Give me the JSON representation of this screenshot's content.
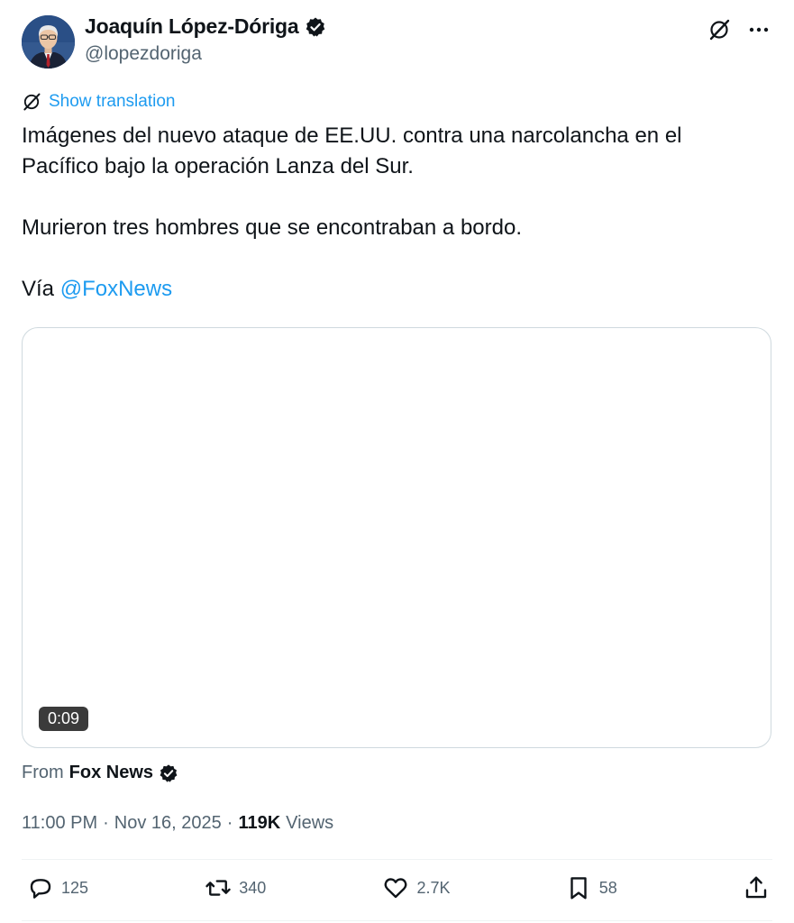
{
  "author": {
    "display_name": "Joaquín López-Dóriga",
    "handle": "@lopezdoriga"
  },
  "translate": {
    "label": "Show translation"
  },
  "tweet": {
    "line1": "Imágenes del nuevo ataque de EE.UU. contra una narcolancha en el Pacífico bajo la operación Lanza del Sur.",
    "line2": "Murieron tres hombres que se encontraban a bordo.",
    "via_prefix": "Vía ",
    "mention": "@FoxNews"
  },
  "media": {
    "duration": "0:09"
  },
  "source": {
    "from_label": "From",
    "name": "Fox News"
  },
  "meta": {
    "time": "11:00 PM",
    "separator": "·",
    "date": "Nov 16, 2025",
    "views_count": "119K",
    "views_label": "Views"
  },
  "actions": {
    "replies": "125",
    "reposts": "340",
    "likes": "2.7K",
    "bookmarks": "58"
  },
  "colors": {
    "accent": "#1d9bf0",
    "text": "#0f1419",
    "secondary": "#536471"
  }
}
